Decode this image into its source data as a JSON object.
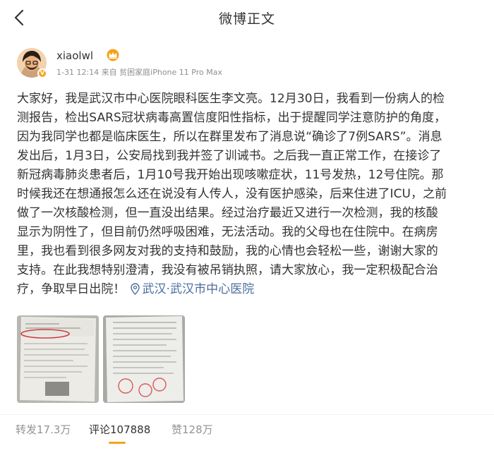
{
  "header": {
    "title": "微博正文"
  },
  "post": {
    "author": "xiaolwl",
    "meta": "1-31 12:14 来自 贫困家庭iPhone 11 Pro Max",
    "text": "大家好，我是武汉市中心医院眼科医生李文亮。12月30日，我看到一份病人的检\n测报告，检出SARS冠状病毒高置信度阳性指标，出于提醒同学注意防护的角度，\n因为我同学也都是临床医生，所以在群里发布了消息说“确诊了7例SARS”。消息\n发出后，1月3日，公安局找到我并签了训诫书。之后我一直正常工作，在接诊了\n新冠病毒肺炎患者后，1月10号我开始出现咳嗽症状，11号发热，12号住院。那\n时候我还在想通报怎么还在说没有人传人，没有医护感染，后来住进了ICU，之前\n做了一次核酸检测，但一直没出结果。经过治疗最近又进行一次检测，我的核酸\n显示为阴性了，但目前仍然呼吸困难，无法活动。我的父母也在住院中。在病房\n里，我也看到很多网友对我的支持和鼓励，我的心情也会轻松一些，谢谢大家的\n支持。在此我想特别澄清，我没有被吊销执照，请大家放心，我一定积极配合治\n疗，争取早日出院！",
    "location": "武汉·武汉市中心医院"
  },
  "actions": {
    "repost": "转发17.3万",
    "comment": "评论107888",
    "like": "赞128万"
  },
  "colors": {
    "accent": "#f5a31a",
    "link": "#4b6e9d",
    "muted": "#939393"
  },
  "icons": {
    "back": "chevron-left-icon",
    "location": "location-pin-icon",
    "badge": "crown-icon"
  }
}
